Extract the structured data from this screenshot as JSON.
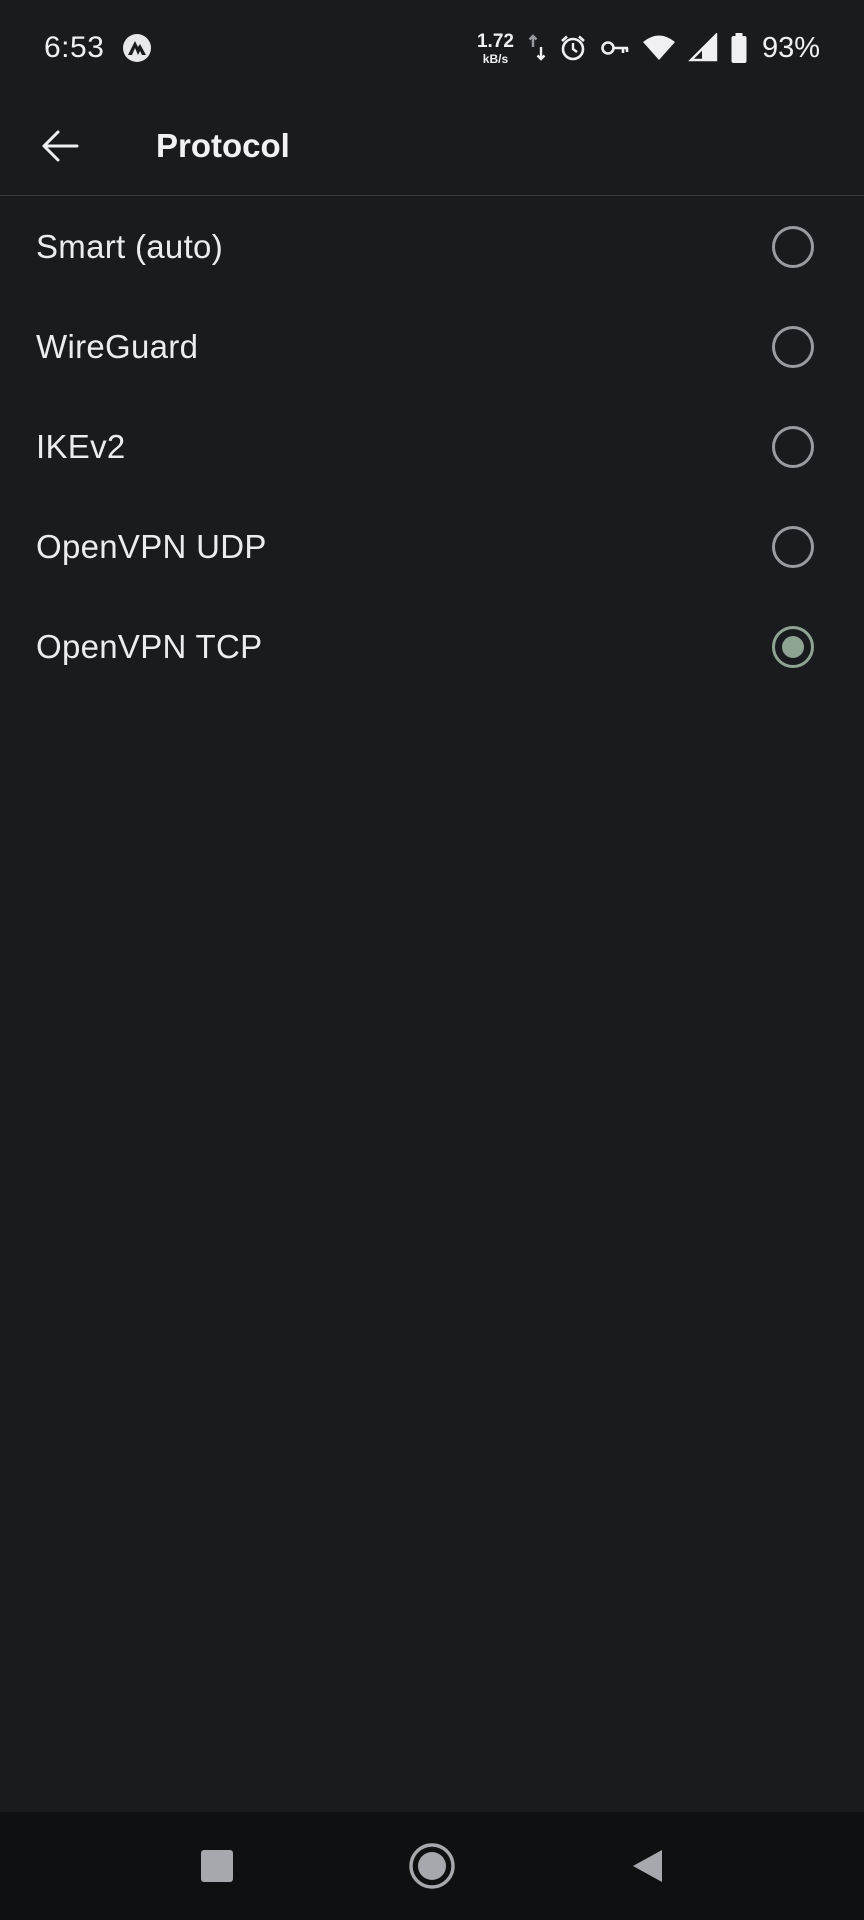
{
  "status_bar": {
    "time": "6:53",
    "net_speed_value": "1.72",
    "net_speed_unit": "kB/s",
    "battery_percent": "93%",
    "icons": [
      "nordvpn-icon",
      "data-transfer-icon",
      "alarm-icon",
      "vpn-key-icon",
      "wifi-icon",
      "cell-signal-icon",
      "battery-icon"
    ]
  },
  "app_bar": {
    "title": "Protocol",
    "back_icon": "arrow-back-icon"
  },
  "protocols": {
    "selected": "OpenVPN TCP",
    "options": [
      {
        "label": "Smart (auto)",
        "checked": false
      },
      {
        "label": "WireGuard",
        "checked": false
      },
      {
        "label": "IKEv2",
        "checked": false
      },
      {
        "label": "OpenVPN UDP",
        "checked": false
      },
      {
        "label": "OpenVPN TCP",
        "checked": true
      }
    ]
  },
  "nav_bar": {
    "buttons": [
      "recents-square-icon",
      "home-circle-icon",
      "back-triangle-icon"
    ]
  },
  "colors": {
    "background": "#1a1b1f",
    "radio_unchecked": "#9a9ba0",
    "radio_checked": "#8fa393",
    "nav_bar": "#0f1012"
  }
}
